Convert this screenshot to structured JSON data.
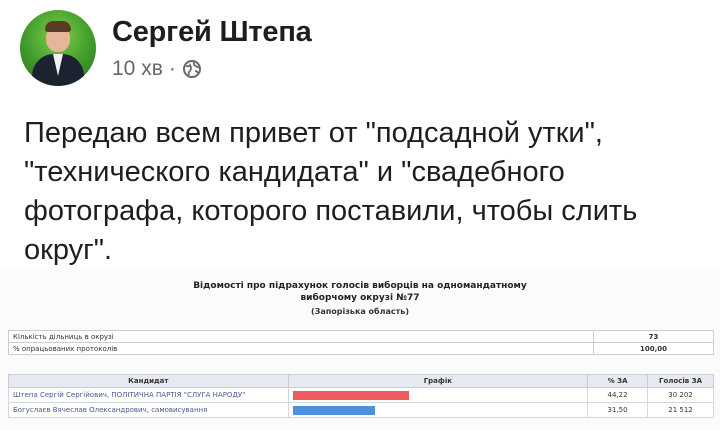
{
  "post": {
    "author": "Сергей Штепа",
    "time": "10 хв",
    "separator": "·",
    "text": "Передаю всем привет от \"подсадной утки\", \"технического кандидата\" и \"свадебного фотографа, которого поставили, чтобы слить округ\"."
  },
  "document": {
    "title_line1": "Відомості про підрахунок голосів виборців на одномандатному",
    "title_line2": "виборчому окрузі №77",
    "subtitle": "(Запорізька область)",
    "info_rows": [
      {
        "label": "Кількість дільниць в окрузі",
        "value": "73"
      },
      {
        "label": "% опрацьованих протоколів",
        "value": "100,00"
      }
    ],
    "columns": {
      "candidate": "Кандидат",
      "chart": "Графік",
      "percent": "% ЗА",
      "votes": "Голосів ЗА"
    },
    "candidates": [
      {
        "name": "Штепа Сергій Сергійович, ПОЛІТИЧНА ПАРТІЯ \"СЛУГА НАРОДУ\"",
        "percent": "44,22",
        "votes": "30 202",
        "share": 0.4422,
        "color": "#ee5c60"
      },
      {
        "name": "Богуслаєв Вячеслав Олександрович, самовисування",
        "percent": "31,50",
        "votes": "21 512",
        "share": 0.315,
        "color": "#4a90e0"
      }
    ]
  },
  "icons": {
    "audience": "globe-icon"
  }
}
